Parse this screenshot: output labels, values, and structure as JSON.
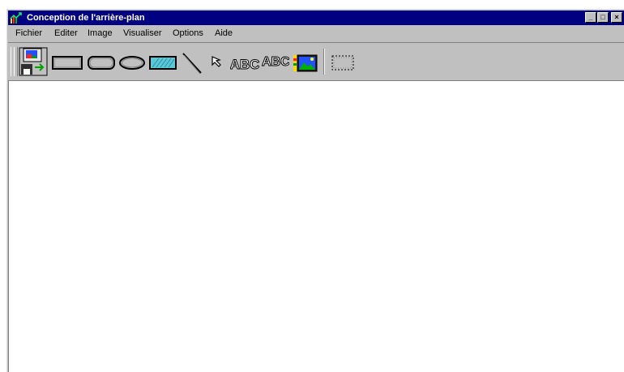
{
  "window": {
    "title": "Conception de l'arrière-plan",
    "controls": {
      "minimize": "_",
      "maximize": "□",
      "close": "×"
    }
  },
  "menu": {
    "items": [
      "Fichier",
      "Editer",
      "Image",
      "Visualiser",
      "Options",
      "Aide"
    ]
  },
  "toolbar": {
    "tools": [
      {
        "icon": "save-image-icon"
      },
      {
        "icon": "rectangle-icon"
      },
      {
        "icon": "rounded-rectangle-icon"
      },
      {
        "icon": "ellipse-icon"
      },
      {
        "icon": "filled-rectangle-icon"
      },
      {
        "icon": "line-icon"
      },
      {
        "icon": "pointer-arrow-icon"
      },
      {
        "icon": "text-icon",
        "text": "ABC"
      },
      {
        "icon": "curved-text-icon",
        "text": "ABC"
      },
      {
        "icon": "picture-icon"
      },
      {
        "icon": "selection-rectangle-icon"
      }
    ]
  },
  "colors": {
    "title_bar": "#000080",
    "window_face": "#c0c0c0",
    "canvas": "#ffffff",
    "filled_rect_fill": "#5bc8d8"
  }
}
